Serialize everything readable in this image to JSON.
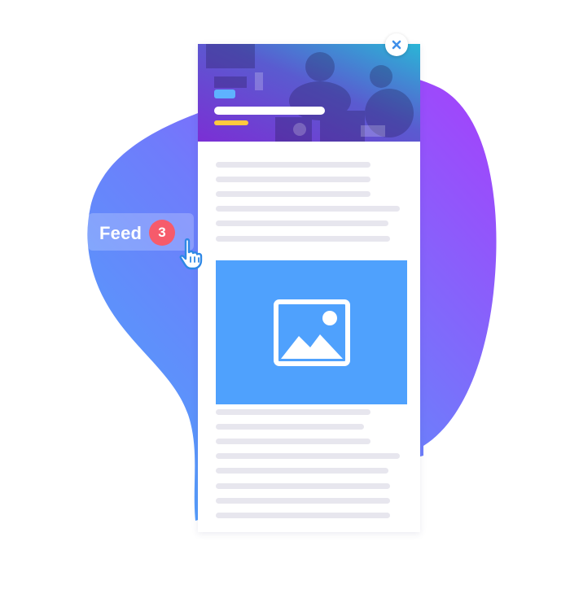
{
  "feed_tab": {
    "label": "Feed",
    "badge_count": "3"
  },
  "icons": {
    "close": "close-icon",
    "image": "image-icon",
    "cursor": "hand-pointer-icon"
  },
  "colors": {
    "blob_start": "#4fa4fb",
    "blob_end": "#a443fb",
    "header_overlay_start": "#7b2fd4",
    "header_overlay_end": "#2ab6d6",
    "image_block": "#4fa1fd",
    "badge": "#f65b6b",
    "close_icon": "#3f8fea",
    "placeholder_line": "#e7e6ee",
    "header_tag": "#5eb2ff",
    "header_accent": "#ffc93f"
  }
}
